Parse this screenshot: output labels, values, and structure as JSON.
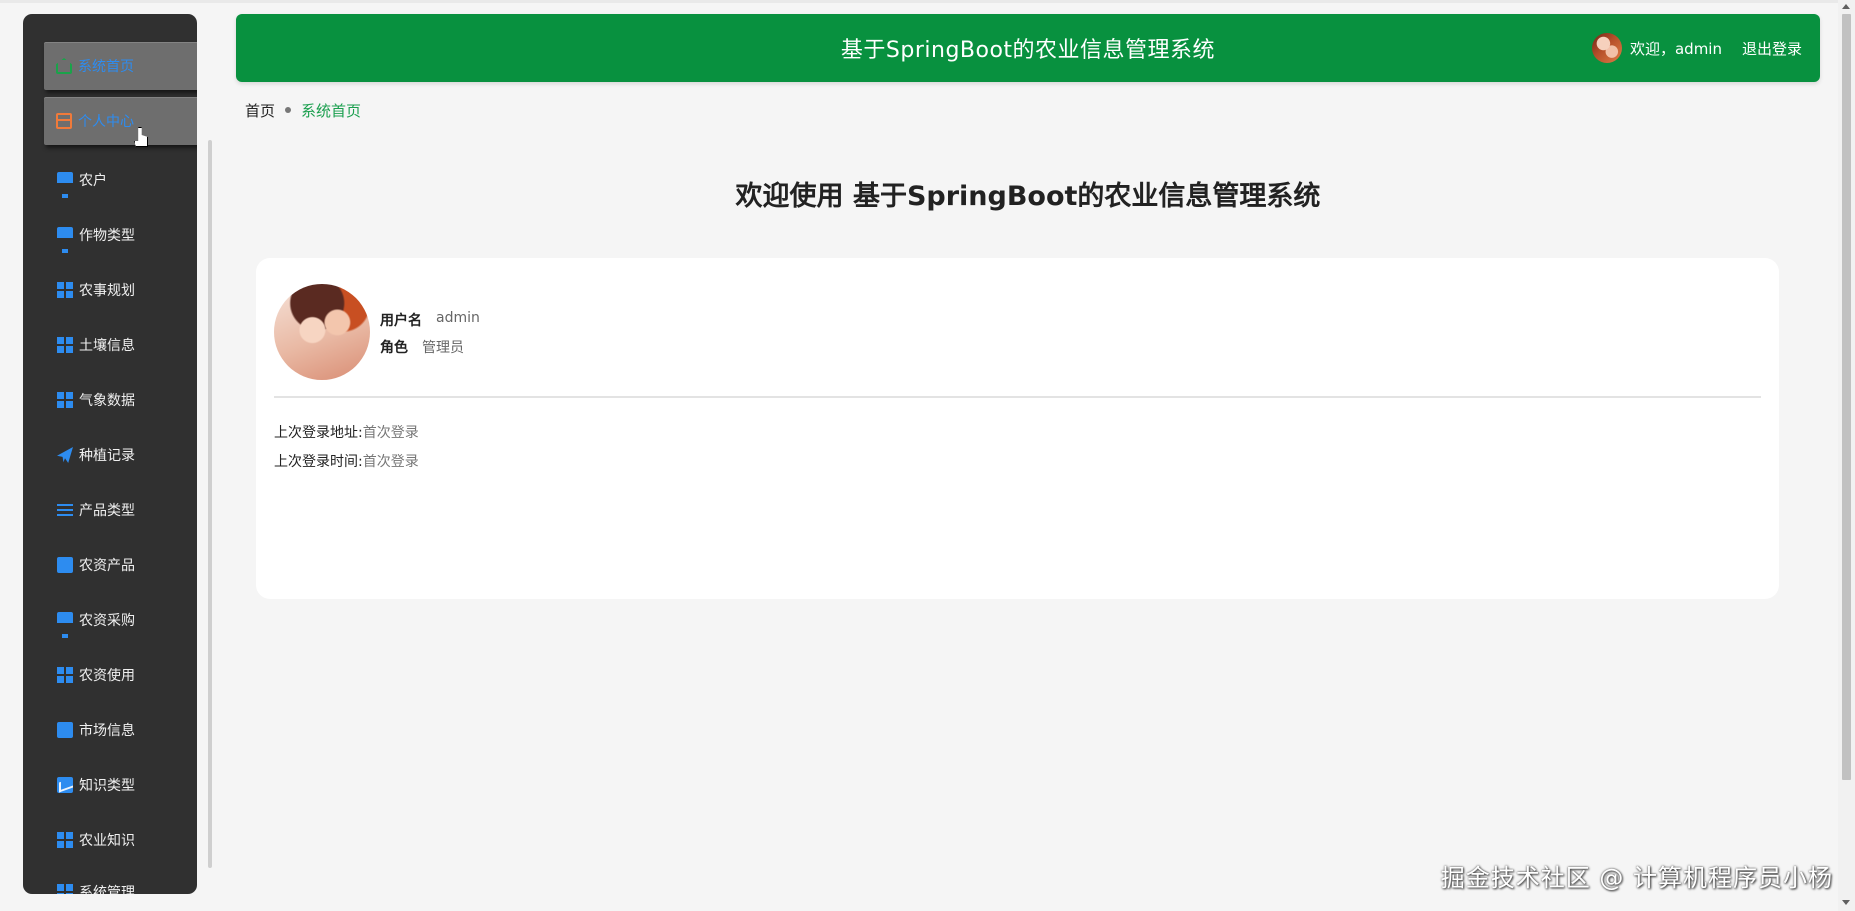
{
  "app": {
    "title": "基于SpringBoot的农业信息管理系统",
    "accent_color": "#08913f",
    "link_color": "#2d8cf0"
  },
  "header": {
    "welcome": "欢迎，admin",
    "logout_label": "退出登录",
    "avatar_icon": "avatar-icon"
  },
  "sidebar": {
    "items": [
      {
        "label": "系统首页",
        "icon": "home-icon",
        "state": "raised"
      },
      {
        "label": "个人中心",
        "icon": "id-card-icon",
        "state": "raised-hover"
      },
      {
        "label": "农户",
        "icon": "monitor-icon"
      },
      {
        "label": "作物类型",
        "icon": "monitor-icon"
      },
      {
        "label": "农事规划",
        "icon": "grid-icon"
      },
      {
        "label": "土壤信息",
        "icon": "grid-icon"
      },
      {
        "label": "气象数据",
        "icon": "grid-icon"
      },
      {
        "label": "种植记录",
        "icon": "paper-plane-icon"
      },
      {
        "label": "产品类型",
        "icon": "sliders-icon"
      },
      {
        "label": "农资产品",
        "icon": "clipboard-icon"
      },
      {
        "label": "农资采购",
        "icon": "monitor-icon"
      },
      {
        "label": "农资使用",
        "icon": "grid-icon"
      },
      {
        "label": "市场信息",
        "icon": "clipboard-icon"
      },
      {
        "label": "知识类型",
        "icon": "chart-icon"
      },
      {
        "label": "农业知识",
        "icon": "grid-icon"
      },
      {
        "label": "系统管理",
        "icon": "grid-icon"
      }
    ]
  },
  "breadcrumb": {
    "home": "首页",
    "current": "系统首页"
  },
  "main": {
    "welcome_heading": "欢迎使用 基于SpringBoot的农业信息管理系统",
    "user": {
      "username_label": "用户名",
      "username_value": "admin",
      "role_label": "角色",
      "role_value": "管理员",
      "last_login_addr_label": "上次登录地址:",
      "last_login_addr_value": "首次登录",
      "last_login_time_label": "上次登录时间:",
      "last_login_time_value": "首次登录"
    }
  },
  "watermark": "掘金技术社区 @ 计算机程序员小杨"
}
